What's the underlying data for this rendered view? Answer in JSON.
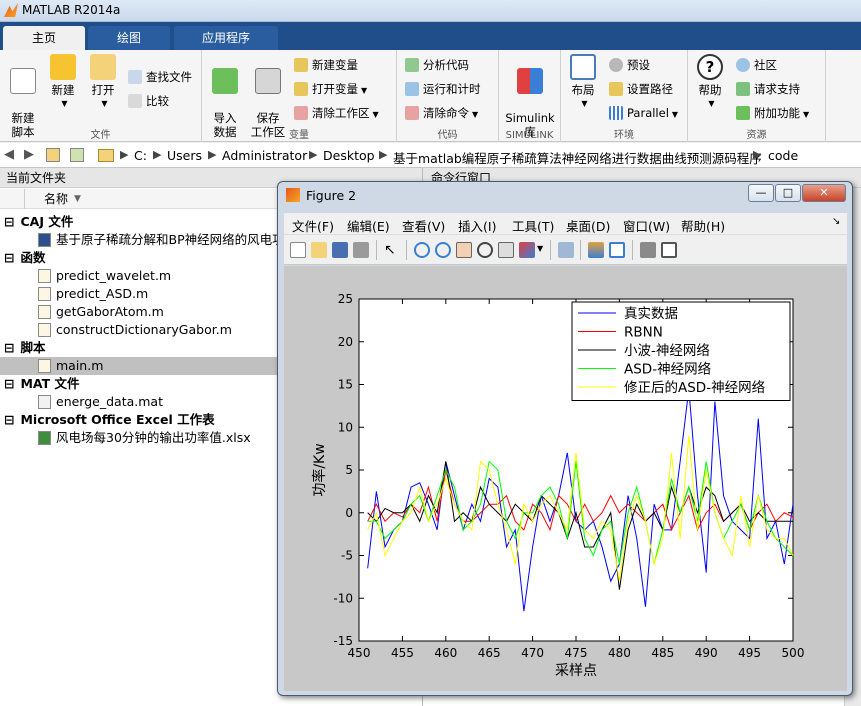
{
  "app": {
    "title": "MATLAB R2014a"
  },
  "tabs": [
    {
      "label": "主页"
    },
    {
      "label": "绘图"
    },
    {
      "label": "应用程序"
    }
  ],
  "ribbon": {
    "file": {
      "label": "文件",
      "new_script": "新建\n脚本",
      "new": "新建",
      "open": "打开",
      "find_files": "查找文件",
      "compare": "比较"
    },
    "variable": {
      "label": "变量",
      "import": "导入\n数据",
      "save_ws": "保存\n工作区",
      "new_var": "新建变量",
      "open_var": "打开变量",
      "clear_ws": "清除工作区"
    },
    "code": {
      "label": "代码",
      "analyze": "分析代码",
      "run_time": "运行和计时",
      "clear_cmd": "清除命令"
    },
    "simulink": {
      "label": "SIMULINK",
      "lib": "Simulink\n库"
    },
    "env": {
      "label": "环境",
      "layout": "布局",
      "prefs": "预设",
      "set_path": "设置路径",
      "parallel": "Parallel"
    },
    "res": {
      "label": "资源",
      "help": "帮助",
      "community": "社区",
      "support": "请求支持",
      "addons": "附加功能"
    }
  },
  "address": {
    "crumbs": [
      "C:",
      "Users",
      "Administrator",
      "Desktop",
      "基于matlab编程原子稀疏算法神经网络进行数据曲线预测源码程序",
      "code"
    ]
  },
  "filepanel": {
    "title": "当前文件夹",
    "col_name": "名称",
    "groups": [
      {
        "label": "CAJ 文件",
        "files": [
          "基于原子稀疏分解和BP神经网络的风电功"
        ]
      },
      {
        "label": "函数",
        "files": [
          "predict_wavelet.m",
          "predict_ASD.m",
          "getGaborAtom.m",
          "constructDictionaryGabor.m"
        ]
      },
      {
        "label": "脚本",
        "files": [
          "main.m"
        ]
      },
      {
        "label": "MAT 文件",
        "files": [
          "energe_data.mat"
        ]
      },
      {
        "label": "Microsoft Office Excel 工作表",
        "files": [
          "风电场每30分钟的输出功率值.xlsx"
        ]
      }
    ]
  },
  "cmdpanel": {
    "title": "命令行窗口"
  },
  "figure": {
    "title": "Figure 2",
    "menu": [
      "文件(F)",
      "编辑(E)",
      "查看(V)",
      "插入(I)",
      "工具(T)",
      "桌面(D)",
      "窗口(W)",
      "帮助(H)"
    ]
  },
  "chart_data": {
    "type": "line",
    "xlabel": "采样点",
    "ylabel": "功率/Kw",
    "xlim": [
      450,
      500
    ],
    "ylim": [
      -15,
      25
    ],
    "xticks": [
      450,
      455,
      460,
      465,
      470,
      475,
      480,
      485,
      490,
      495,
      500
    ],
    "yticks": [
      -15,
      -10,
      -5,
      0,
      5,
      10,
      15,
      20,
      25
    ],
    "legend_position": "top-right",
    "x": [
      451,
      452,
      453,
      454,
      455,
      456,
      457,
      458,
      459,
      460,
      461,
      462,
      463,
      464,
      465,
      466,
      467,
      468,
      469,
      470,
      471,
      472,
      473,
      474,
      475,
      476,
      477,
      478,
      479,
      480,
      481,
      482,
      483,
      484,
      485,
      486,
      487,
      488,
      489,
      490,
      491,
      492,
      493,
      494,
      495,
      496,
      497,
      498,
      499,
      500
    ],
    "series": [
      {
        "name": "真实数据",
        "color": "#0000ff",
        "values": [
          -6.5,
          2.5,
          -4,
          -2,
          -1,
          3,
          3.5,
          1,
          -2,
          6,
          2,
          -2,
          1,
          -1,
          4,
          3,
          -4,
          -2,
          -11.5,
          -4,
          2,
          -1,
          2,
          7,
          -1,
          -2,
          -1,
          -4,
          -8,
          -6,
          2,
          -3,
          -11,
          1,
          -2,
          -2,
          6,
          14.5,
          2,
          -7,
          13,
          2,
          -1,
          -2,
          -3,
          11,
          -3,
          -1,
          -6,
          1
        ]
      },
      {
        "name": "RBNN",
        "color": "#ff0000",
        "values": [
          -1,
          1,
          -1,
          0,
          -0.5,
          1,
          0,
          3,
          -1,
          5,
          1,
          -1,
          -1,
          0,
          1,
          1,
          2,
          -1,
          -2,
          1,
          0,
          -2,
          2,
          1,
          -1,
          1,
          -1,
          0,
          2,
          0,
          1,
          0,
          -1,
          0,
          1,
          -2,
          0,
          2,
          -2,
          0,
          1,
          -1,
          0,
          1,
          -2,
          0,
          1,
          -1,
          0,
          -0.5
        ]
      },
      {
        "name": "小波-神经网络",
        "color": "#000000",
        "values": [
          0,
          -1,
          0.5,
          0,
          0,
          1,
          -1,
          2,
          0,
          6,
          -1,
          0,
          -1,
          3,
          1,
          0,
          -1,
          1,
          0,
          -1,
          2,
          1,
          0,
          -3,
          0,
          -4,
          -4,
          -2,
          0,
          -9,
          -2,
          1,
          -1,
          0,
          -2,
          3,
          0,
          3,
          0,
          3,
          2,
          -1,
          0,
          1,
          -1,
          0,
          -1,
          -1,
          -1,
          -1
        ]
      },
      {
        "name": "ASD-神经网络",
        "color": "#00ff00",
        "values": [
          -1,
          -1,
          -3,
          -2,
          -1,
          1,
          2,
          -1,
          2,
          5,
          3,
          -2,
          -1,
          1,
          6,
          5,
          -1,
          -3,
          0,
          0,
          2,
          3,
          1,
          -3,
          6,
          -3,
          -5,
          -2,
          -1,
          -6,
          0,
          3,
          -1,
          -6,
          -2,
          4,
          0,
          3,
          -1,
          6,
          0,
          -3,
          -1,
          1,
          -2,
          2,
          -1,
          -3,
          -4,
          -5
        ]
      },
      {
        "name": "修正后的ASD-神经网络",
        "color": "#ffff00",
        "values": [
          -2,
          0,
          -5,
          -3,
          -1,
          0,
          3,
          -1,
          1,
          4,
          1,
          -1,
          -2,
          6,
          5,
          1,
          -2,
          -6,
          1,
          -1,
          1,
          2,
          0,
          -2,
          7,
          -2,
          -3,
          -1,
          -2,
          -8,
          -1,
          2,
          -1,
          -6,
          -3,
          7,
          -3,
          9,
          -2,
          5,
          0,
          -3,
          -5,
          2,
          -4,
          2,
          -2,
          -3,
          -3,
          -5
        ]
      }
    ]
  }
}
